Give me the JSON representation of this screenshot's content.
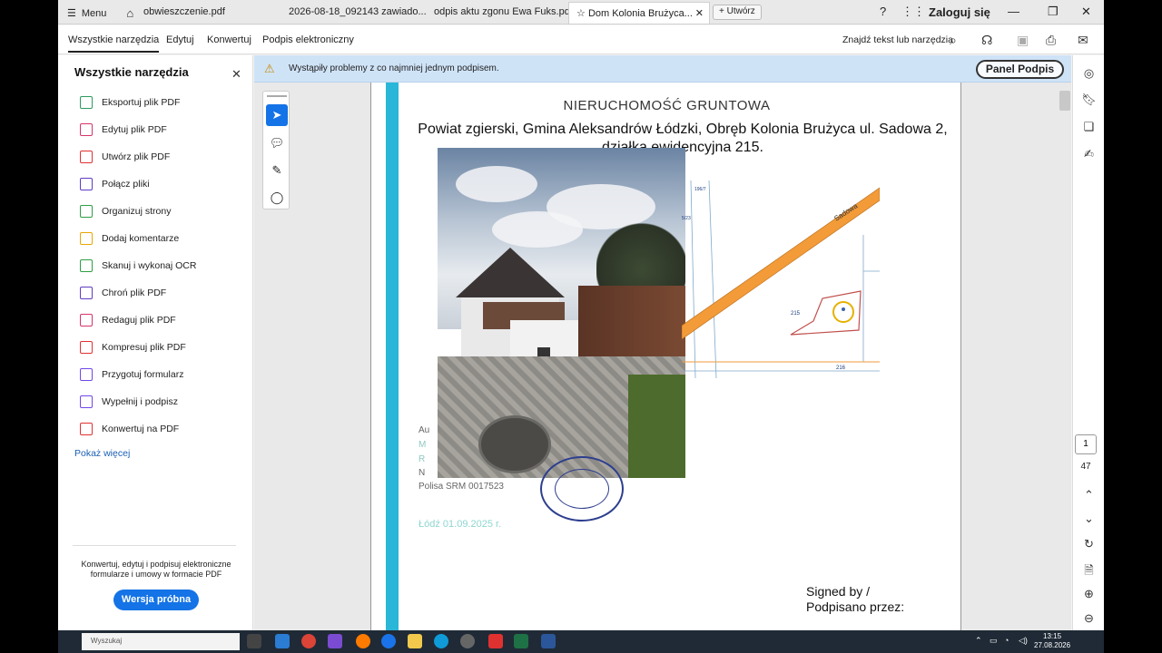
{
  "tabbar": {
    "menu_label": "Menu",
    "tabs": [
      {
        "label": "obwieszczenie.pdf"
      },
      {
        "label": "2026-08-18_092143 zawiado..."
      },
      {
        "label": "odpis aktu zgonu Ewa Fuks.pdf"
      },
      {
        "label": "Dom Kolonia Brużyca..."
      }
    ],
    "new_tab_label": "Utwórz",
    "login_label": "Zaloguj się"
  },
  "toolbar": {
    "items": [
      "Wszystkie narzędzia",
      "Edytuj",
      "Konwertuj",
      "Podpis elektroniczny"
    ],
    "search_label": "Znajdź tekst lub narzędzia"
  },
  "left_panel": {
    "title": "Wszystkie narzędzia",
    "tools": [
      {
        "label": "Eksportuj plik PDF",
        "color": "#2e9a5e"
      },
      {
        "label": "Edytuj plik PDF",
        "color": "#d6336c"
      },
      {
        "label": "Utwórz plik PDF",
        "color": "#e03131"
      },
      {
        "label": "Połącz pliki",
        "color": "#5f3dc4"
      },
      {
        "label": "Organizuj strony",
        "color": "#2f9e44"
      },
      {
        "label": "Dodaj komentarze",
        "color": "#e6a700"
      },
      {
        "label": "Skanuj i wykonaj OCR",
        "color": "#2f9e44"
      },
      {
        "label": "Chroń plik PDF",
        "color": "#5f3dc4"
      },
      {
        "label": "Redaguj plik PDF",
        "color": "#d6336c"
      },
      {
        "label": "Kompresuj plik PDF",
        "color": "#e03131"
      },
      {
        "label": "Przygotuj formularz",
        "color": "#7048e8"
      },
      {
        "label": "Wypełnij i podpisz",
        "color": "#7048e8"
      },
      {
        "label": "Konwertuj na PDF",
        "color": "#e03131"
      }
    ],
    "show_more": "Pokaż więcej",
    "promo_text": "Konwertuj, edytuj i podpisuj elektroniczne formularze i umowy w formacie PDF",
    "trial_button": "Wersja próbna"
  },
  "banner": {
    "text": "Wystąpiły problemy z co najmniej jednym podpisem.",
    "panel_button": "Panel Podpis"
  },
  "document": {
    "title": "NIERUCHOMOŚĆ GRUNTOWA",
    "subtitle": "Powiat zgierski, Gmina Aleksandrów Łódzki, Obręb Kolonia Brużyca ul. Sadowa 2, działka ewidencyjna 215.",
    "map_labels": {
      "street": "Sadowa",
      "parcel": "215",
      "top1": "196/7",
      "left1": "5/23",
      "bottom": "216"
    },
    "addr_lines": [
      "Au",
      "M",
      "R",
      "N",
      "Polisa SRM 0017523"
    ],
    "date": "Łódź 01.09.2025 r.",
    "signed": [
      "Signed by /",
      "Podpisano przez:"
    ]
  },
  "page_nav": {
    "current": "1",
    "total": "47"
  },
  "taskbar": {
    "search_text": "Wyszukaj",
    "time": "13:15",
    "date": "27.08.2026"
  },
  "colors": {
    "accent": "#1473e6",
    "cyan_bar": "#29b6d8",
    "banner": "#cfe3f7"
  }
}
